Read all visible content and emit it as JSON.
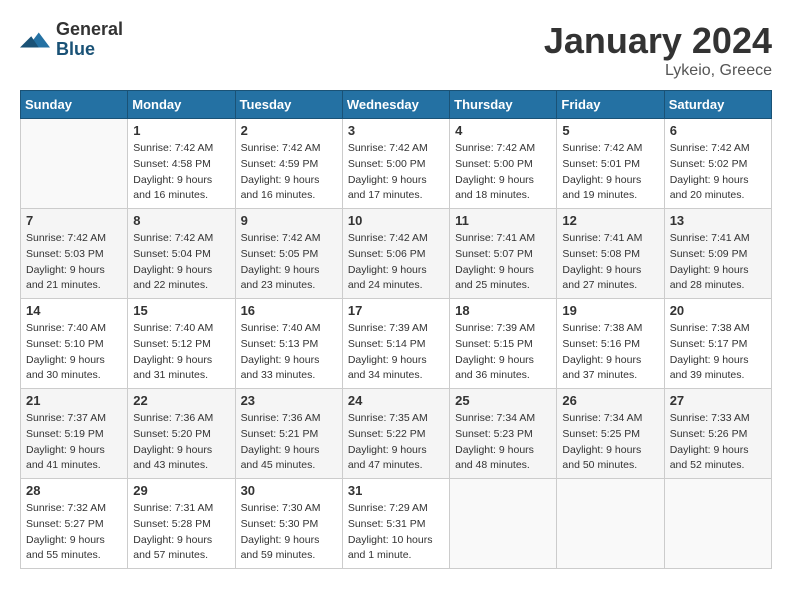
{
  "logo": {
    "general": "General",
    "blue": "Blue"
  },
  "title": "January 2024",
  "location": "Lykeio, Greece",
  "days_of_week": [
    "Sunday",
    "Monday",
    "Tuesday",
    "Wednesday",
    "Thursday",
    "Friday",
    "Saturday"
  ],
  "weeks": [
    [
      {
        "day": "",
        "sunrise": "",
        "sunset": "",
        "daylight": ""
      },
      {
        "day": "1",
        "sunrise": "Sunrise: 7:42 AM",
        "sunset": "Sunset: 4:58 PM",
        "daylight": "Daylight: 9 hours and 16 minutes."
      },
      {
        "day": "2",
        "sunrise": "Sunrise: 7:42 AM",
        "sunset": "Sunset: 4:59 PM",
        "daylight": "Daylight: 9 hours and 16 minutes."
      },
      {
        "day": "3",
        "sunrise": "Sunrise: 7:42 AM",
        "sunset": "Sunset: 5:00 PM",
        "daylight": "Daylight: 9 hours and 17 minutes."
      },
      {
        "day": "4",
        "sunrise": "Sunrise: 7:42 AM",
        "sunset": "Sunset: 5:00 PM",
        "daylight": "Daylight: 9 hours and 18 minutes."
      },
      {
        "day": "5",
        "sunrise": "Sunrise: 7:42 AM",
        "sunset": "Sunset: 5:01 PM",
        "daylight": "Daylight: 9 hours and 19 minutes."
      },
      {
        "day": "6",
        "sunrise": "Sunrise: 7:42 AM",
        "sunset": "Sunset: 5:02 PM",
        "daylight": "Daylight: 9 hours and 20 minutes."
      }
    ],
    [
      {
        "day": "7",
        "sunrise": "Sunrise: 7:42 AM",
        "sunset": "Sunset: 5:03 PM",
        "daylight": "Daylight: 9 hours and 21 minutes."
      },
      {
        "day": "8",
        "sunrise": "Sunrise: 7:42 AM",
        "sunset": "Sunset: 5:04 PM",
        "daylight": "Daylight: 9 hours and 22 minutes."
      },
      {
        "day": "9",
        "sunrise": "Sunrise: 7:42 AM",
        "sunset": "Sunset: 5:05 PM",
        "daylight": "Daylight: 9 hours and 23 minutes."
      },
      {
        "day": "10",
        "sunrise": "Sunrise: 7:42 AM",
        "sunset": "Sunset: 5:06 PM",
        "daylight": "Daylight: 9 hours and 24 minutes."
      },
      {
        "day": "11",
        "sunrise": "Sunrise: 7:41 AM",
        "sunset": "Sunset: 5:07 PM",
        "daylight": "Daylight: 9 hours and 25 minutes."
      },
      {
        "day": "12",
        "sunrise": "Sunrise: 7:41 AM",
        "sunset": "Sunset: 5:08 PM",
        "daylight": "Daylight: 9 hours and 27 minutes."
      },
      {
        "day": "13",
        "sunrise": "Sunrise: 7:41 AM",
        "sunset": "Sunset: 5:09 PM",
        "daylight": "Daylight: 9 hours and 28 minutes."
      }
    ],
    [
      {
        "day": "14",
        "sunrise": "Sunrise: 7:40 AM",
        "sunset": "Sunset: 5:10 PM",
        "daylight": "Daylight: 9 hours and 30 minutes."
      },
      {
        "day": "15",
        "sunrise": "Sunrise: 7:40 AM",
        "sunset": "Sunset: 5:12 PM",
        "daylight": "Daylight: 9 hours and 31 minutes."
      },
      {
        "day": "16",
        "sunrise": "Sunrise: 7:40 AM",
        "sunset": "Sunset: 5:13 PM",
        "daylight": "Daylight: 9 hours and 33 minutes."
      },
      {
        "day": "17",
        "sunrise": "Sunrise: 7:39 AM",
        "sunset": "Sunset: 5:14 PM",
        "daylight": "Daylight: 9 hours and 34 minutes."
      },
      {
        "day": "18",
        "sunrise": "Sunrise: 7:39 AM",
        "sunset": "Sunset: 5:15 PM",
        "daylight": "Daylight: 9 hours and 36 minutes."
      },
      {
        "day": "19",
        "sunrise": "Sunrise: 7:38 AM",
        "sunset": "Sunset: 5:16 PM",
        "daylight": "Daylight: 9 hours and 37 minutes."
      },
      {
        "day": "20",
        "sunrise": "Sunrise: 7:38 AM",
        "sunset": "Sunset: 5:17 PM",
        "daylight": "Daylight: 9 hours and 39 minutes."
      }
    ],
    [
      {
        "day": "21",
        "sunrise": "Sunrise: 7:37 AM",
        "sunset": "Sunset: 5:19 PM",
        "daylight": "Daylight: 9 hours and 41 minutes."
      },
      {
        "day": "22",
        "sunrise": "Sunrise: 7:36 AM",
        "sunset": "Sunset: 5:20 PM",
        "daylight": "Daylight: 9 hours and 43 minutes."
      },
      {
        "day": "23",
        "sunrise": "Sunrise: 7:36 AM",
        "sunset": "Sunset: 5:21 PM",
        "daylight": "Daylight: 9 hours and 45 minutes."
      },
      {
        "day": "24",
        "sunrise": "Sunrise: 7:35 AM",
        "sunset": "Sunset: 5:22 PM",
        "daylight": "Daylight: 9 hours and 47 minutes."
      },
      {
        "day": "25",
        "sunrise": "Sunrise: 7:34 AM",
        "sunset": "Sunset: 5:23 PM",
        "daylight": "Daylight: 9 hours and 48 minutes."
      },
      {
        "day": "26",
        "sunrise": "Sunrise: 7:34 AM",
        "sunset": "Sunset: 5:25 PM",
        "daylight": "Daylight: 9 hours and 50 minutes."
      },
      {
        "day": "27",
        "sunrise": "Sunrise: 7:33 AM",
        "sunset": "Sunset: 5:26 PM",
        "daylight": "Daylight: 9 hours and 52 minutes."
      }
    ],
    [
      {
        "day": "28",
        "sunrise": "Sunrise: 7:32 AM",
        "sunset": "Sunset: 5:27 PM",
        "daylight": "Daylight: 9 hours and 55 minutes."
      },
      {
        "day": "29",
        "sunrise": "Sunrise: 7:31 AM",
        "sunset": "Sunset: 5:28 PM",
        "daylight": "Daylight: 9 hours and 57 minutes."
      },
      {
        "day": "30",
        "sunrise": "Sunrise: 7:30 AM",
        "sunset": "Sunset: 5:30 PM",
        "daylight": "Daylight: 9 hours and 59 minutes."
      },
      {
        "day": "31",
        "sunrise": "Sunrise: 7:29 AM",
        "sunset": "Sunset: 5:31 PM",
        "daylight": "Daylight: 10 hours and 1 minute."
      },
      {
        "day": "",
        "sunrise": "",
        "sunset": "",
        "daylight": ""
      },
      {
        "day": "",
        "sunrise": "",
        "sunset": "",
        "daylight": ""
      },
      {
        "day": "",
        "sunrise": "",
        "sunset": "",
        "daylight": ""
      }
    ]
  ]
}
